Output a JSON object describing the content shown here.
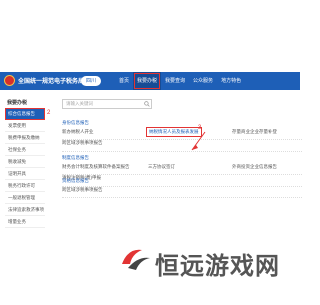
{
  "header": {
    "site_title": "全国统一规范电子税务局",
    "region_button": "四川",
    "nav": [
      "首页",
      "我要办税",
      "我要查询",
      "公众服务",
      "地方特色"
    ],
    "active_nav": "我要办税"
  },
  "sidebar": {
    "header": "我要办税",
    "items": [
      {
        "label": "综合信息报告",
        "active": true
      },
      {
        "label": "发票使用"
      },
      {
        "label": "税费申报及缴纳"
      },
      {
        "label": "社保业务"
      },
      {
        "label": "税收减免"
      },
      {
        "label": "证明开具"
      },
      {
        "label": "税务行政许可"
      },
      {
        "label": "一般退税管理"
      },
      {
        "label": "法律追索救济事项"
      },
      {
        "label": "增量业务"
      }
    ]
  },
  "annotations": {
    "marker_2": "2",
    "marker_3": "3"
  },
  "main": {
    "search_placeholder": "请输入关键词",
    "sections": [
      {
        "title": "身份信息报告"
      },
      {
        "title": "制度信息报告"
      },
      {
        "title": "资格信息报告"
      }
    ],
    "rows": [
      [
        "新办纳税人开业",
        "纳税情况人员及报表发展",
        "存量商业企业存量补登"
      ],
      [
        "跨区域涉税事项报告"
      ],
      [
        "财务会计制度及核算软件备案报告",
        "三方协议签订",
        "外商投资企业信息报告"
      ],
      [
        "清税注销税(费)申报"
      ],
      [
        "跨区域涉税事项报告"
      ]
    ],
    "highlight_link": "纳税情况人员及报表发展"
  },
  "watermark": {
    "text": "恒远游戏网"
  }
}
